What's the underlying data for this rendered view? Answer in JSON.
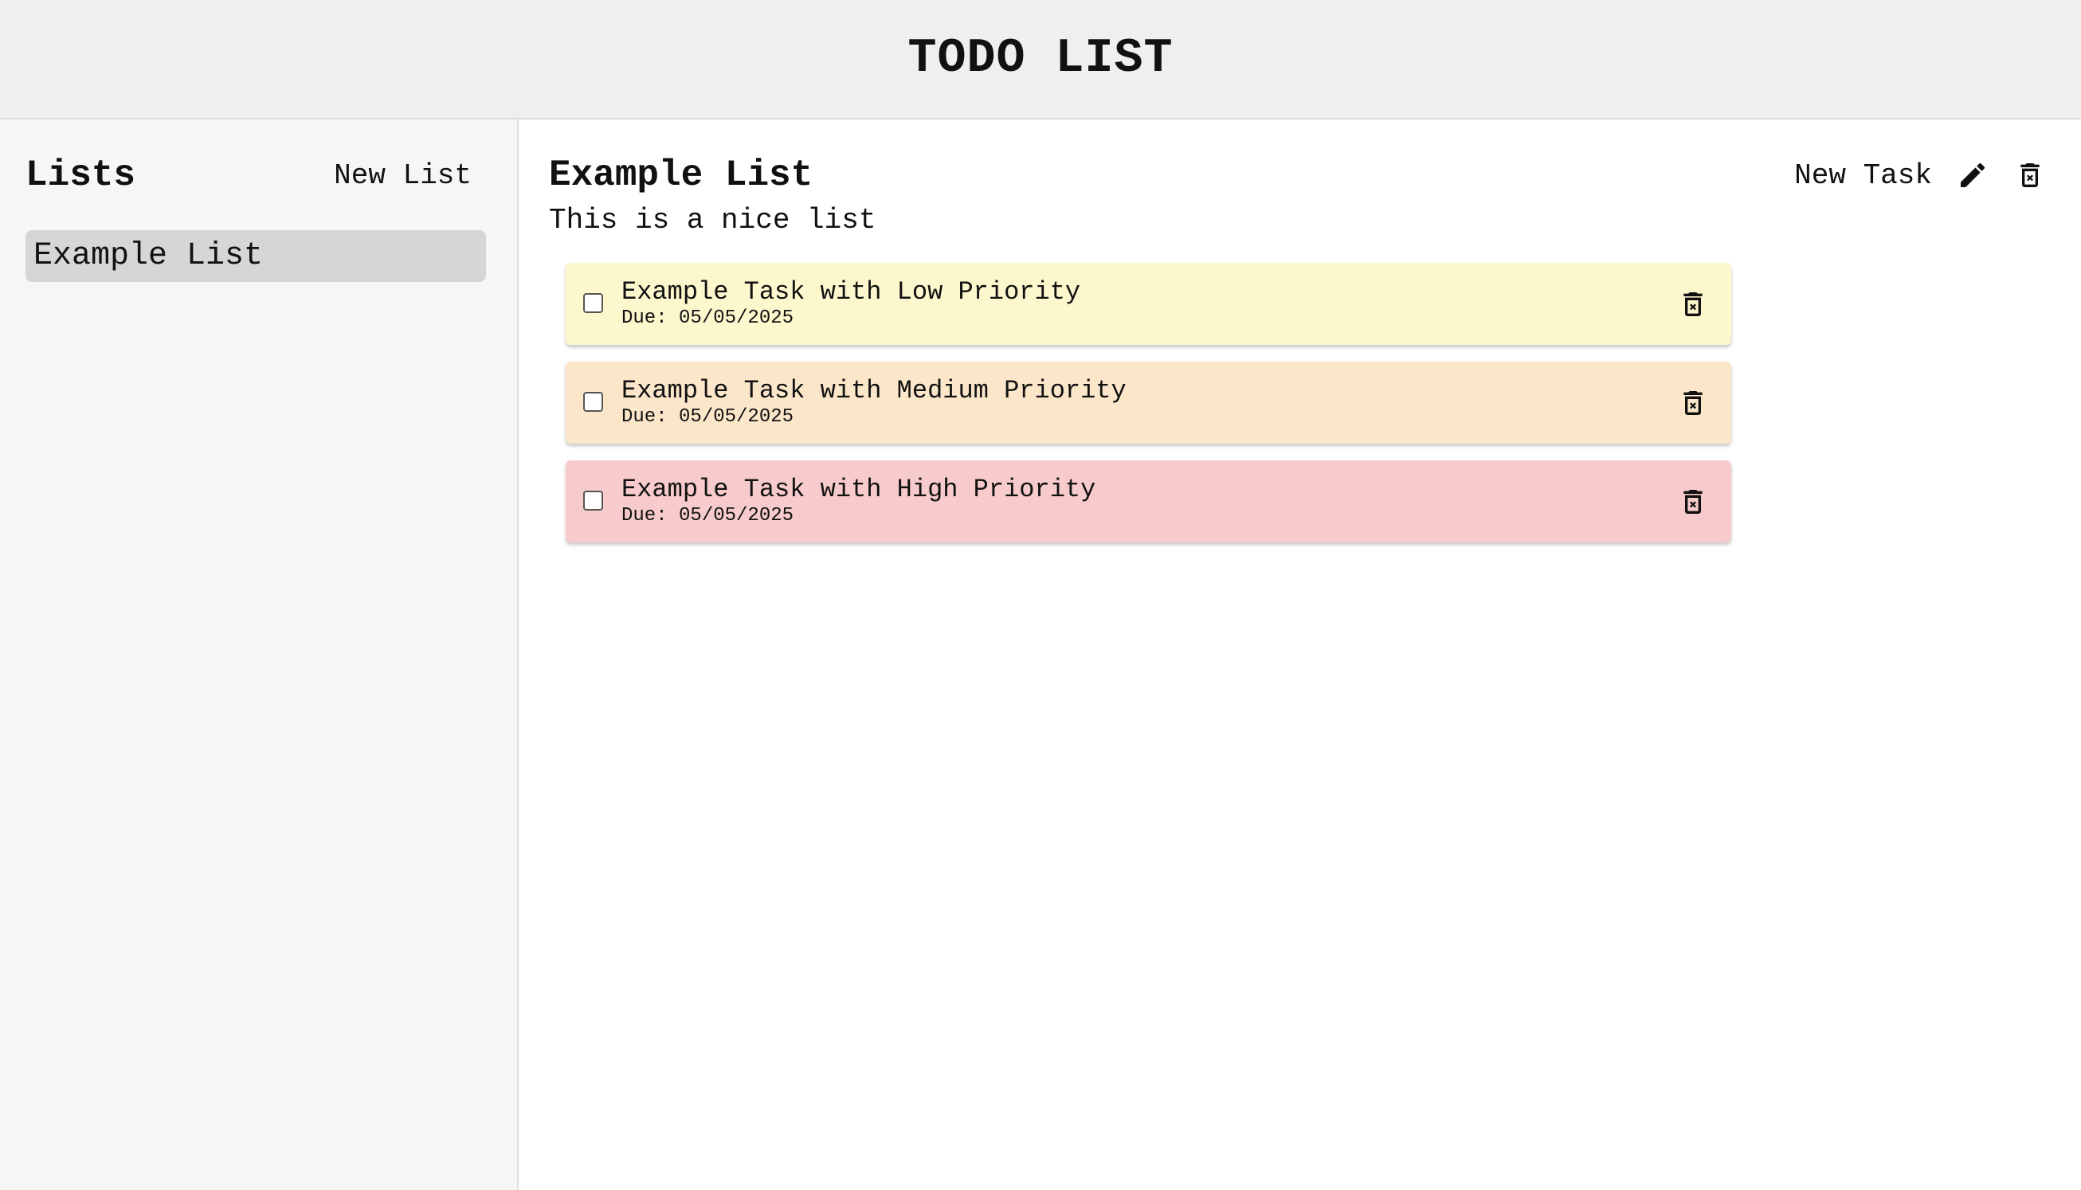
{
  "app": {
    "title": "TODO LIST"
  },
  "sidebar": {
    "title": "Lists",
    "new_list_label": "New List",
    "items": [
      {
        "label": "Example List",
        "selected": true
      }
    ]
  },
  "main": {
    "list_title": "Example List",
    "list_description": "This is a nice list",
    "new_task_label": "New Task",
    "edit_icon": "pencil-icon",
    "delete_icon": "trash-icon",
    "tasks": [
      {
        "title": "Example Task with Low Priority",
        "due": "Due: 05/05/2025",
        "priority": "low",
        "checked": false,
        "color": "#fcf7cd"
      },
      {
        "title": "Example Task with Medium Priority",
        "due": "Due: 05/05/2025",
        "priority": "medium",
        "checked": false,
        "color": "#fbe6ca"
      },
      {
        "title": "Example Task with High Priority",
        "due": "Due: 05/05/2025",
        "priority": "high",
        "checked": false,
        "color": "#f7cbcb"
      }
    ]
  },
  "colors": {
    "header_bg": "#efefef",
    "sidebar_bg": "#f6f6f6",
    "selected_list_bg": "#d6d6d6"
  }
}
